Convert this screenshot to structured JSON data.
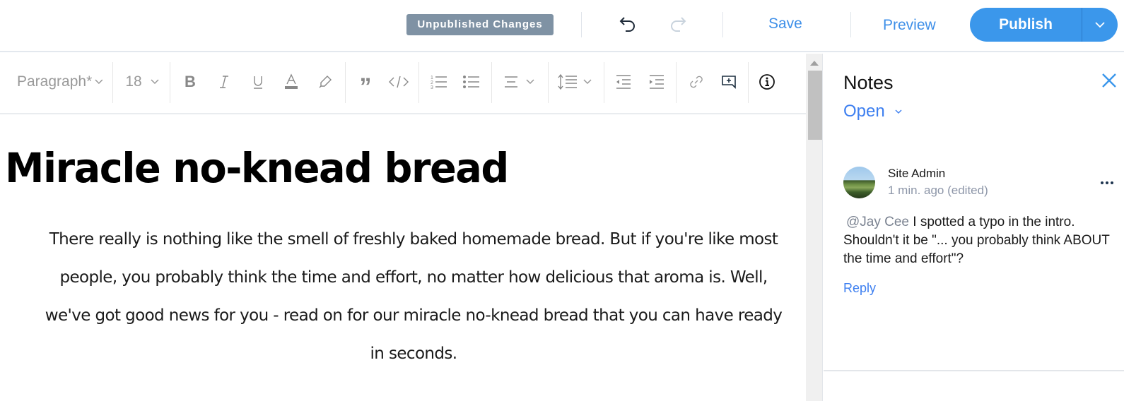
{
  "topbar": {
    "status_badge": "Unpublished Changes",
    "undo_icon": "undo-icon",
    "redo_icon": "redo-icon",
    "save_label": "Save",
    "preview_label": "Preview",
    "publish_label": "Publish",
    "publish_menu_icon": "chevron-down-icon"
  },
  "toolbar": {
    "paragraph_style": "Paragraph*",
    "font_size": "18",
    "buttons": [
      "bold",
      "italic",
      "underline",
      "text-color",
      "highlight",
      "blockquote",
      "code-block",
      "numbered-list",
      "bulleted-list",
      "text-alignment",
      "line-spacing",
      "decrease-indent",
      "increase-indent",
      "link",
      "add-note",
      "info"
    ]
  },
  "document": {
    "title": "Miracle no-knead bread",
    "paragraph": "There really is nothing like the smell of freshly baked homemade bread. But if you're like most people, you probably think the time and effort, no matter how delicious that aroma is. Well, we've got good news for you - read on for our miracle no-knead bread that you can have ready in seconds."
  },
  "notes": {
    "title": "Notes",
    "filter": "Open",
    "items": [
      {
        "author": "Site Admin",
        "time": "1 min. ago (edited)",
        "mention": "@Jay Cee",
        "text": "I spotted a typo in the intro. Shouldn't it be \"... you probably think ABOUT the time and effort\"?",
        "reply_label": "Reply"
      }
    ]
  },
  "colors": {
    "accent": "#3b97eb",
    "link": "#3d7ff0",
    "badge": "#7f92a4"
  }
}
